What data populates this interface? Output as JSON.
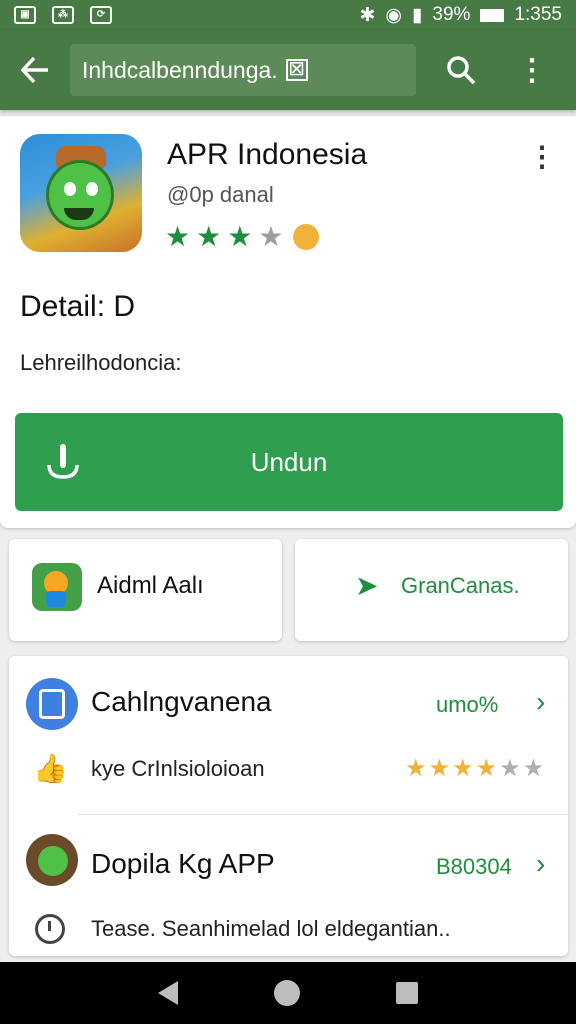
{
  "status_bar": {
    "left_icons": [
      "image-icon",
      "signal-icon",
      "sync-icon"
    ],
    "battery_percent": "39%",
    "time": "1:355"
  },
  "toolbar": {
    "search_text": "Inhdcalbenndunga.",
    "icons": [
      "back-arrow-icon",
      "qr-icon",
      "search-icon",
      "more-vert-icon"
    ]
  },
  "app": {
    "title": "APR Indonesia",
    "developer": "@0p danal",
    "rating_stars": 3,
    "detail_title": "Detail: D",
    "detail_desc": "Lehreilhodoncia:",
    "install_label": "Undun"
  },
  "quick_actions": [
    {
      "label": "Aidml Aalı",
      "icon": "app-avatar-icon"
    },
    {
      "label": "GranCanas.",
      "icon": "send-icon"
    }
  ],
  "list": [
    {
      "title": "Cahlngvanena",
      "value": "umo%",
      "sub_text": "kye CrInlsioloioan",
      "sub_rating": 4
    },
    {
      "title": "Dopila Kg APP",
      "value": "B80304",
      "sub_text": "Tease. Seanhimelad lol eldegantian.."
    }
  ],
  "colors": {
    "primary": "#477a45",
    "accent": "#2f9e4f",
    "star_green": "#1e8e3e",
    "star_yellow": "#f2b13a"
  }
}
